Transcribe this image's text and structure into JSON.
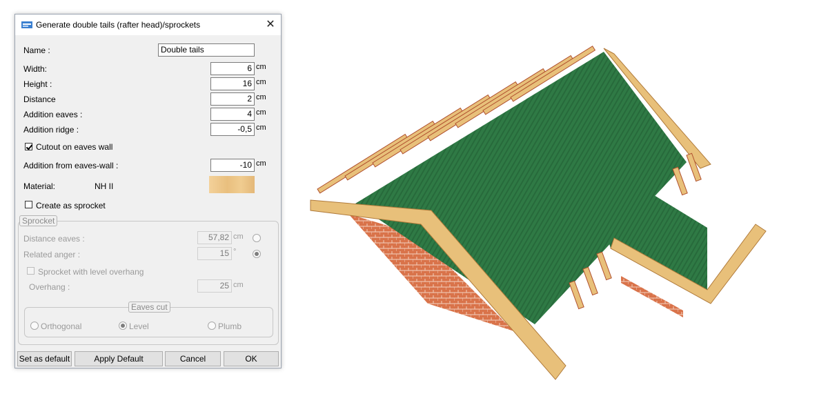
{
  "dialog": {
    "title": "Generate double tails (rafter head)/sprockets",
    "close_label": "✕",
    "name_label": "Name :",
    "name_value": "Double tails",
    "fields": [
      {
        "label": "Width:",
        "value": "6",
        "unit": "cm"
      },
      {
        "label": "Height :",
        "value": "16",
        "unit": "cm"
      },
      {
        "label": "Distance",
        "value": "2",
        "unit": "cm"
      },
      {
        "label": "Addition eaves :",
        "value": "4",
        "unit": "cm"
      },
      {
        "label": "Addition ridge :",
        "value": "-0,5",
        "unit": "cm"
      }
    ],
    "cutout_label": "Cutout on eaves wall",
    "cutout_checked": true,
    "addition_eaves_wall_label": "Addition from eaves-wall :",
    "addition_eaves_wall_value": "-10",
    "addition_eaves_wall_unit": "cm",
    "material_label": "Material:",
    "material_value": "NH II",
    "create_sprocket_label": "Create as sprocket",
    "create_sprocket_checked": false,
    "sprocket": {
      "legend": "Sprocket",
      "distance_eaves_label": "Distance eaves :",
      "distance_eaves_value": "57,82",
      "distance_eaves_unit": "cm",
      "related_anger_label": "Related anger :",
      "related_anger_value": "15",
      "related_anger_unit": "°",
      "level_overhang_label": "Sprocket with level overhang",
      "overhang_label": "Overhang :",
      "overhang_value": "25",
      "overhang_unit": "cm",
      "eaves_cut": {
        "legend": "Eaves cut",
        "options": [
          "Orthogonal",
          "Level",
          "Plumb"
        ],
        "selected": "Level"
      }
    },
    "buttons": {
      "set_default": "Set as default",
      "apply_default": "Apply Default",
      "cancel": "Cancel",
      "ok": "OK"
    }
  },
  "colors": {
    "roof_green": "#2e7d4a",
    "wood": "#e8c07a",
    "brick": "#c9643a"
  }
}
